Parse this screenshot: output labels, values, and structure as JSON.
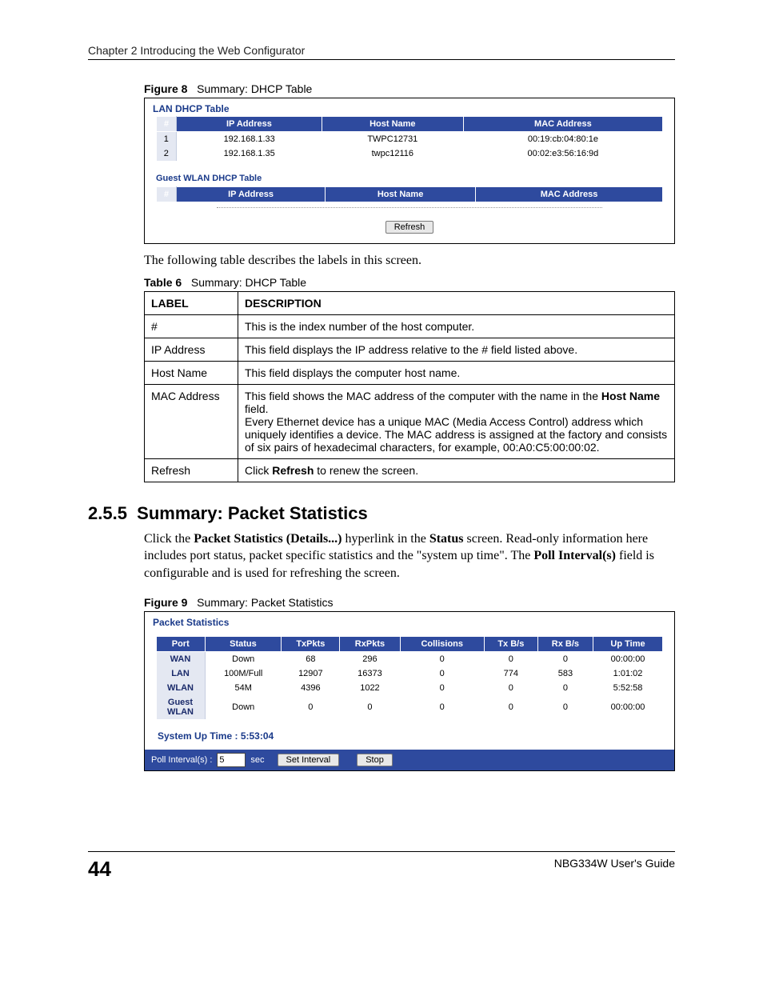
{
  "chapter": "Chapter 2 Introducing the Web Configurator",
  "figure8": {
    "caption_num": "Figure 8",
    "caption_title": "Summary: DHCP Table",
    "section_lan": "LAN DHCP Table",
    "section_guest": "Guest WLAN DHCP Table",
    "headers": {
      "num": "#",
      "ip": "IP Address",
      "host": "Host Name",
      "mac": "MAC Address"
    },
    "rows": [
      {
        "num": "1",
        "ip": "192.168.1.33",
        "host": "TWPC12731",
        "mac": "00:19:cb:04:80:1e"
      },
      {
        "num": "2",
        "ip": "192.168.1.35",
        "host": "twpc12116",
        "mac": "00:02:e3:56:16:9d"
      }
    ],
    "refresh_label": "Refresh"
  },
  "between_text": "The following table describes the labels in this screen.",
  "table6": {
    "caption_num": "Table 6",
    "caption_title": "Summary: DHCP Table",
    "head_label": "LABEL",
    "head_desc": "DESCRIPTION",
    "rows": [
      {
        "label": "#",
        "desc": "This is the index number of the host computer."
      },
      {
        "label": "IP Address",
        "desc": "This field displays the IP address relative to the # field listed above."
      },
      {
        "label": "Host Name",
        "desc": "This field displays the computer host name."
      },
      {
        "label": "MAC Address",
        "p1a": "This field shows the MAC address of the computer with the name in the ",
        "p1b": "Host Name",
        "p1c": " field.",
        "p2": "Every Ethernet device has a unique MAC (Media Access Control) address which uniquely identifies a device. The MAC address is assigned at the factory and consists of six pairs of hexadecimal characters, for example, 00:A0:C5:00:00:02."
      },
      {
        "label": "Refresh",
        "d1": "Click ",
        "d1b": "Refresh",
        "d1c": " to renew the screen."
      }
    ]
  },
  "section_255": {
    "num": "2.5.5",
    "title": "Summary: Packet Statistics",
    "p1a": "Click the ",
    "p1b": "Packet Statistics (Details...)",
    "p1c": " hyperlink in the ",
    "p1d": "Status",
    "p1e": " screen. Read-only information here includes port status, packet specific statistics and the \"system up time\". The ",
    "p1f": "Poll Interval(s)",
    "p1g": " field is configurable and is used for refreshing the screen."
  },
  "figure9": {
    "caption_num": "Figure 9",
    "caption_title": "Summary: Packet Statistics",
    "title": "Packet Statistics",
    "headers": {
      "port": "Port",
      "status": "Status",
      "txpkts": "TxPkts",
      "rxpkts": "RxPkts",
      "coll": "Collisions",
      "txbs": "Tx B/s",
      "rxbs": "Rx B/s",
      "uptime": "Up Time"
    },
    "rows": [
      {
        "port": "WAN",
        "status": "Down",
        "tx": "68",
        "rx": "296",
        "coll": "0",
        "txbs": "0",
        "rxbs": "0",
        "up": "00:00:00"
      },
      {
        "port": "LAN",
        "status": "100M/Full",
        "tx": "12907",
        "rx": "16373",
        "coll": "0",
        "txbs": "774",
        "rxbs": "583",
        "up": "1:01:02"
      },
      {
        "port": "WLAN",
        "status": "54M",
        "tx": "4396",
        "rx": "1022",
        "coll": "0",
        "txbs": "0",
        "rxbs": "0",
        "up": "5:52:58"
      },
      {
        "port": "Guest WLAN",
        "status": "Down",
        "tx": "0",
        "rx": "0",
        "coll": "0",
        "txbs": "0",
        "rxbs": "0",
        "up": "00:00:00"
      }
    ],
    "sys_up_label": "System Up Time : ",
    "sys_up_value": "5:53:04",
    "poll_label": "Poll Interval(s) :",
    "poll_value": "5",
    "poll_unit": "sec",
    "set_interval": "Set Interval",
    "stop": "Stop"
  },
  "footer": {
    "page": "44",
    "guide": "NBG334W User's Guide"
  }
}
